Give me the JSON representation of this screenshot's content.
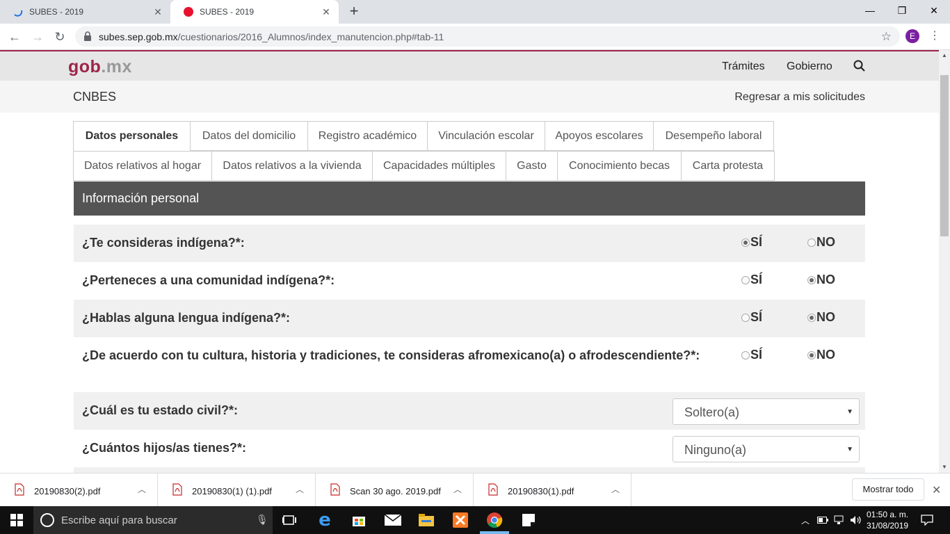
{
  "browser": {
    "tabs": [
      {
        "title": "SUBES - 2019",
        "active": false
      },
      {
        "title": "SUBES - 2019",
        "active": true
      }
    ],
    "url_host": "subes.sep.gob.mx",
    "url_path": "/cuestionarios/2016_Alumnos/index_manutencion.php#tab-11",
    "profile_initial": "E"
  },
  "site": {
    "logo_main": "gob",
    "logo_suffix": ".mx",
    "nav": {
      "tramites": "Trámites",
      "gobierno": "Gobierno"
    },
    "section_name": "CNBES",
    "back_link": "Regresar a mis solicitudes"
  },
  "form_tabs": {
    "row1": [
      "Datos personales",
      "Datos del domicilio",
      "Registro académico",
      "Vinculación escolar",
      "Apoyos escolares",
      "Desempeño laboral"
    ],
    "row2": [
      "Datos relativos al hogar",
      "Datos relativos a la vivienda",
      "Capacidades múltiples",
      "Gasto",
      "Conocimiento becas",
      "Carta protesta"
    ],
    "active": "Datos personales"
  },
  "section": {
    "title": "Información personal"
  },
  "options": {
    "yes": "SÍ",
    "no": "NO"
  },
  "questions": [
    {
      "label": "¿Te consideras indígena?*:",
      "selected": "yes"
    },
    {
      "label": "¿Perteneces a una comunidad indígena?*:",
      "selected": "no"
    },
    {
      "label": "¿Hablas alguna lengua indígena?*:",
      "selected": "no"
    },
    {
      "label": "¿De acuerdo con tu cultura, historia y tradiciones, te consideras afromexicano(a) o afrodescendiente?*:",
      "selected": "no"
    }
  ],
  "selects": [
    {
      "label": "¿Cuál es tu estado civil?*:",
      "value": "Soltero(a)"
    },
    {
      "label": "¿Cuántos hijos/as tienes?*:",
      "value": "Ninguno(a)"
    }
  ],
  "downloads": {
    "files": [
      "20190830(2).pdf",
      "20190830(1) (1).pdf",
      "Scan 30 ago. 2019.pdf",
      "20190830(1).pdf"
    ],
    "show_all": "Mostrar todo"
  },
  "taskbar": {
    "search_placeholder": "Escribe aquí para buscar",
    "time": "01:50 a. m.",
    "date": "31/08/2019"
  },
  "colors": {
    "brand": "#9d2449",
    "header_dark": "#545454",
    "taskbar": "#101010"
  }
}
